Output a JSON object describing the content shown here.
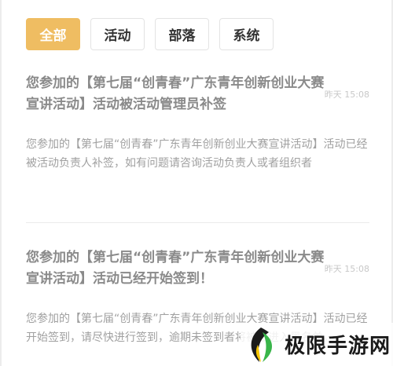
{
  "tabs": [
    {
      "label": "全部",
      "active": true
    },
    {
      "label": "活动",
      "active": false
    },
    {
      "label": "部落",
      "active": false
    },
    {
      "label": "系统",
      "active": false
    }
  ],
  "notices": [
    {
      "title": "您参加的【第七届“创青春”广东青年创新创业大赛宣讲活动】活动被活动管理员补签",
      "time": "昨天 15:08",
      "body": "您参加的【第七届“创青春”广东青年创新创业大赛宣讲活动】活动已经被活动负责人补签，如有问题请咨询活动负责人或者组织者"
    },
    {
      "title": "您参加的【第七届“创青春”广东青年创新创业大赛宣讲活动】活动已经开始签到！",
      "time": "昨天 15:08",
      "body": "您参加的【第七届“创青春”广东青年创新创业大赛宣讲活动】活动已经开始签到，请尽快进行签到，逾期未签到者将被拉进入黑名单。"
    }
  ],
  "watermark": {
    "text": "极限手游网",
    "icon": "leaf-logo-icon",
    "colors": {
      "leaf_dark": "#1b1b1b",
      "leaf_green": "#39b54a",
      "leaf_yellow": "#f5c400"
    }
  },
  "colors": {
    "accent": "#efbd62",
    "title_text": "#8a8a8a",
    "body_text": "#a0a0a0",
    "time_text": "#c8c8c8"
  }
}
